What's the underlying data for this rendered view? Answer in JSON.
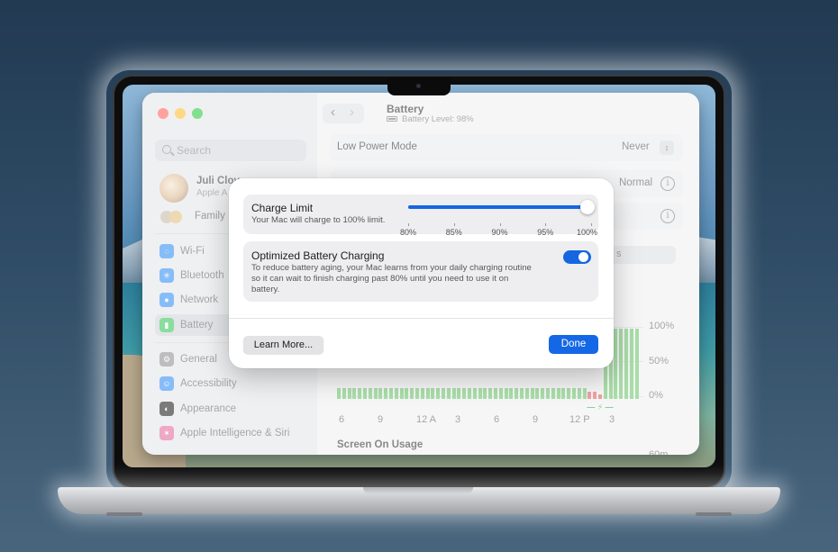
{
  "sidebar": {
    "search_placeholder": "Search",
    "user": {
      "name": "Juli Clov",
      "subtitle": "Apple A"
    },
    "family_label": "Family",
    "items": [
      {
        "label": "Wi-Fi",
        "icon": "wifi-icon",
        "color": "#2f8ef4"
      },
      {
        "label": "Bluetooth",
        "icon": "bluetooth-icon",
        "color": "#2f8ef4"
      },
      {
        "label": "Network",
        "icon": "globe-icon",
        "color": "#2f8ef4"
      },
      {
        "label": "Battery",
        "icon": "battery-icon",
        "color": "#34c759"
      },
      {
        "label": "General",
        "icon": "gear-icon",
        "color": "#8e8e93"
      },
      {
        "label": "Accessibility",
        "icon": "accessibility-icon",
        "color": "#2f8ef4"
      },
      {
        "label": "Appearance",
        "icon": "appearance-icon",
        "color": "#1c1c1e"
      },
      {
        "label": "Apple Intelligence & Siri",
        "icon": "siri-icon",
        "color": "#e36a9a"
      }
    ]
  },
  "pane": {
    "title": "Battery",
    "subtitle": "Battery Level: 98%",
    "low_power_label": "Low Power Mode",
    "low_power_value": "Never",
    "normal_value": "Normal",
    "segment_text": "s"
  },
  "usage_chart": {
    "y_ticks": [
      "100%",
      "50%",
      "0%"
    ],
    "x_ticks": [
      "6",
      "9",
      "12 A",
      "3",
      "6",
      "9",
      "12 P",
      "3"
    ],
    "section_title": "Screen On Usage",
    "cut_tick": "60m"
  },
  "modal": {
    "charge_limit": {
      "title": "Charge Limit",
      "description": "Your Mac will charge to 100% limit.",
      "value_percent": 100,
      "labels": [
        "80%",
        "85%",
        "90%",
        "95%",
        "100%"
      ]
    },
    "optimized": {
      "title": "Optimized Battery Charging",
      "description_lines": [
        "To reduce battery aging, your Mac learns from your daily charging routine",
        "so it can wait to finish charging past 80% until you need to use it on",
        "battery."
      ],
      "enabled": true
    },
    "learn_more": "Learn More...",
    "done": "Done"
  },
  "colors": {
    "accent": "#1566e0",
    "traffic_red": "#ff5f57",
    "traffic_yellow": "#febc2e",
    "traffic_green": "#28c840"
  }
}
